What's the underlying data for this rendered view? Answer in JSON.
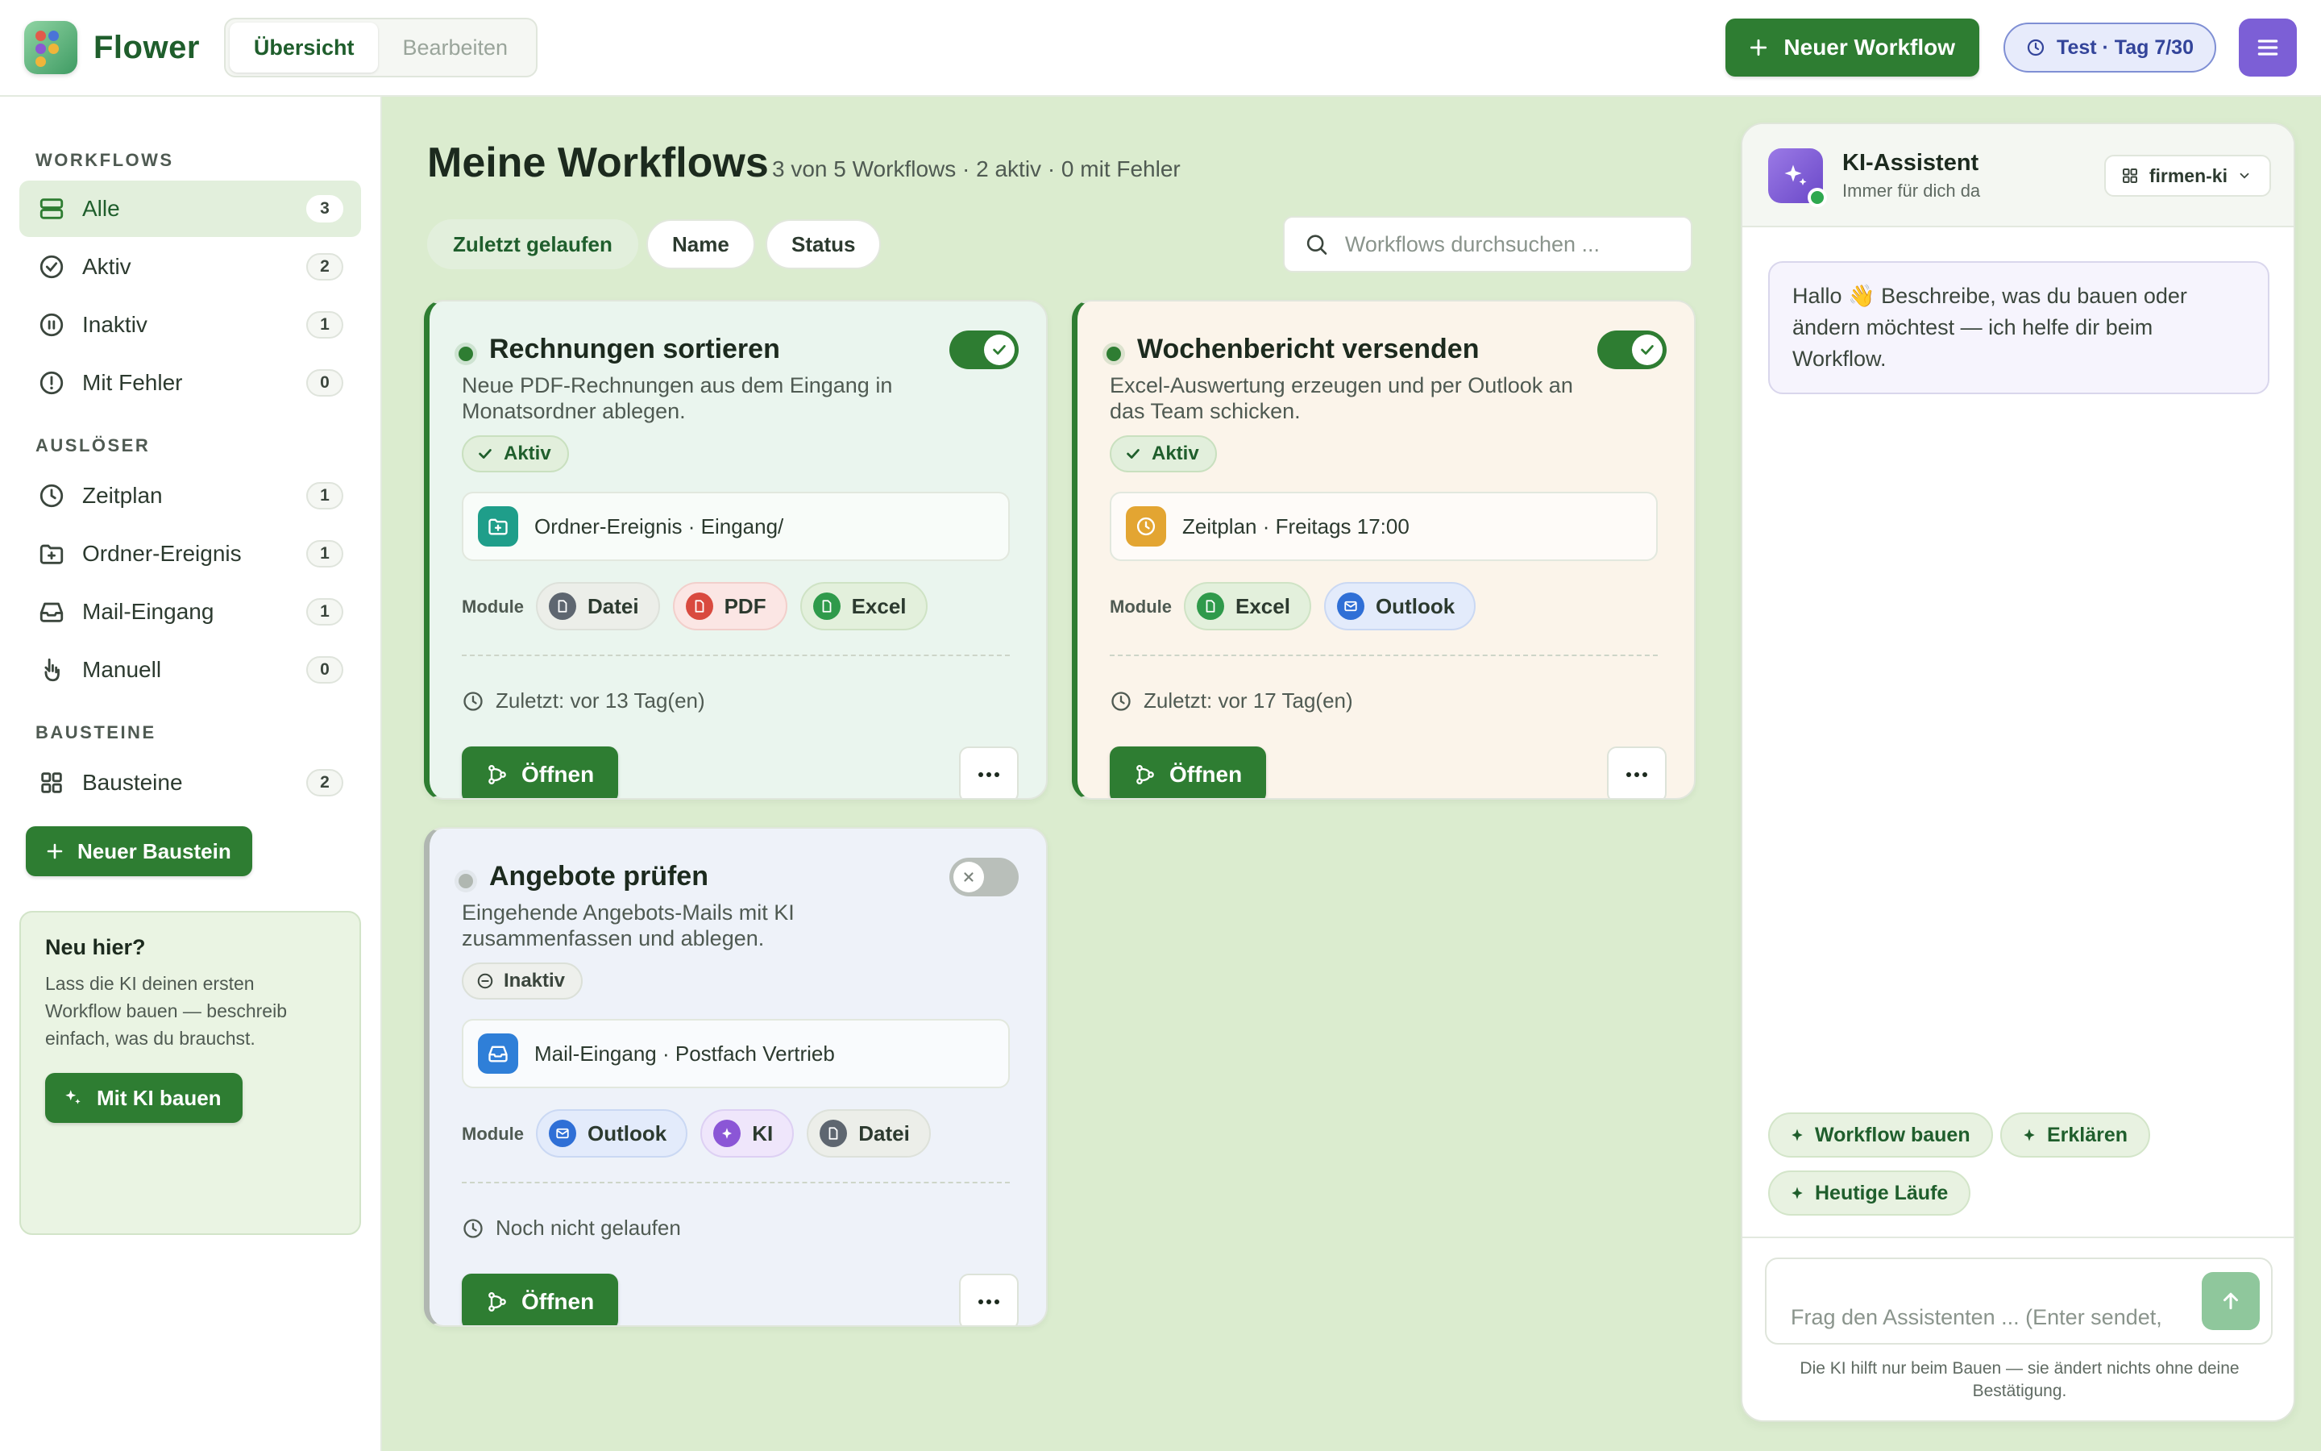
{
  "app": {
    "name": "Flower"
  },
  "header": {
    "tabs": [
      {
        "label": "Übersicht"
      },
      {
        "label": "Bearbeiten"
      }
    ],
    "new_workflow": "Neuer Workflow",
    "trial": "Test · Tag 7/30"
  },
  "sidebar": {
    "sections": {
      "workflows": "WORKFLOWS",
      "triggers": "AUSLÖSER",
      "blocks": "BAUSTEINE"
    },
    "workflows": [
      {
        "label": "Alle",
        "count": "3",
        "icon": "layers-icon"
      },
      {
        "label": "Aktiv",
        "count": "2",
        "icon": "check-circle-icon"
      },
      {
        "label": "Inaktiv",
        "count": "1",
        "icon": "pause-circle-icon"
      },
      {
        "label": "Mit Fehler",
        "count": "0",
        "icon": "alert-circle-icon"
      }
    ],
    "triggers": [
      {
        "label": "Zeitplan",
        "count": "1",
        "icon": "clock-icon"
      },
      {
        "label": "Ordner-Ereignis",
        "count": "1",
        "icon": "folder-icon"
      },
      {
        "label": "Mail-Eingang",
        "count": "1",
        "icon": "inbox-icon"
      },
      {
        "label": "Manuell",
        "count": "0",
        "icon": "hand-pointer-icon"
      }
    ],
    "blocks": [
      {
        "label": "Bausteine",
        "count": "2",
        "icon": "grid-icon"
      }
    ],
    "new_block": "Neuer Baustein",
    "intro": {
      "title": "Neu hier?",
      "text": "Lass die KI deinen ersten Workflow bauen — beschreib einfach, was du brauchst.",
      "button": "Mit KI bauen"
    }
  },
  "main": {
    "title": "Meine Workflows",
    "summary": "3 von 5 Workflows · 2 aktiv · 0 mit Fehler",
    "sort": [
      {
        "label": "Zuletzt gelaufen"
      },
      {
        "label": "Name"
      },
      {
        "label": "Status"
      }
    ],
    "search_placeholder": "Workflows durchsuchen ...",
    "modules_label": "Module",
    "open_label": "Öffnen",
    "workflows": [
      {
        "title": "Rechnungen sortieren",
        "description": "Neue PDF-Rechnungen aus dem Eingang in Monatsordner ablegen.",
        "status": "Aktiv",
        "enabled": true,
        "trigger": "Ordner-Ereignis · Eingang/",
        "trigger_icon": "folder-plus-icon",
        "trigger_color": "#1f9e8a",
        "modules": [
          {
            "label": "Datei",
            "icon": "file-icon"
          },
          {
            "label": "PDF",
            "icon": "file-icon"
          },
          {
            "label": "Excel",
            "icon": "file-icon"
          }
        ],
        "last_run": "Zuletzt: vor 13 Tag(en)",
        "background": "#eaf5ee"
      },
      {
        "title": "Wochenbericht versenden",
        "description": "Excel-Auswertung erzeugen und per Outlook an das Team schicken.",
        "status": "Aktiv",
        "enabled": true,
        "trigger": "Zeitplan · Freitags 17:00",
        "trigger_icon": "clock-icon",
        "trigger_color": "#e3a532",
        "modules": [
          {
            "label": "Excel",
            "icon": "file-icon"
          },
          {
            "label": "Outlook",
            "icon": "mail-icon"
          }
        ],
        "last_run": "Zuletzt: vor 17 Tag(en)",
        "background": "#fbf4ea"
      },
      {
        "title": "Angebote prüfen",
        "description": "Eingehende Angebots-Mails mit KI zusammenfassen und ablegen.",
        "status": "Inaktiv",
        "enabled": false,
        "trigger": "Mail-Eingang · Postfach Vertrieb",
        "trigger_icon": "inbox-icon",
        "trigger_color": "#2f7fd8",
        "modules": [
          {
            "label": "Outlook",
            "icon": "mail-icon"
          },
          {
            "label": "KI",
            "icon": "sparkle-icon"
          },
          {
            "label": "Datei",
            "icon": "file-icon"
          }
        ],
        "last_run": "Noch nicht gelaufen",
        "background": "#eef2f9"
      }
    ]
  },
  "assistant": {
    "name": "KI-Assistent",
    "subtitle": "Immer für dich da",
    "model": "firmen-ki",
    "greeting": "Hallo 👋 Beschreibe, was du bauen oder ändern möchtest — ich helfe dir beim Workflow.",
    "suggestions": [
      {
        "label": "Workflow bauen"
      },
      {
        "label": "Erklären"
      },
      {
        "label": "Heutige Läufe"
      }
    ],
    "input_placeholder": "Frag den Assistenten ... (Enter sendet,",
    "note": "Die KI hilft nur beim Bauen — sie ändert nichts ohne deine Bestätigung."
  },
  "colors": {
    "accent": "#2e7d32",
    "assistant_accent": "#7c5fd6"
  }
}
